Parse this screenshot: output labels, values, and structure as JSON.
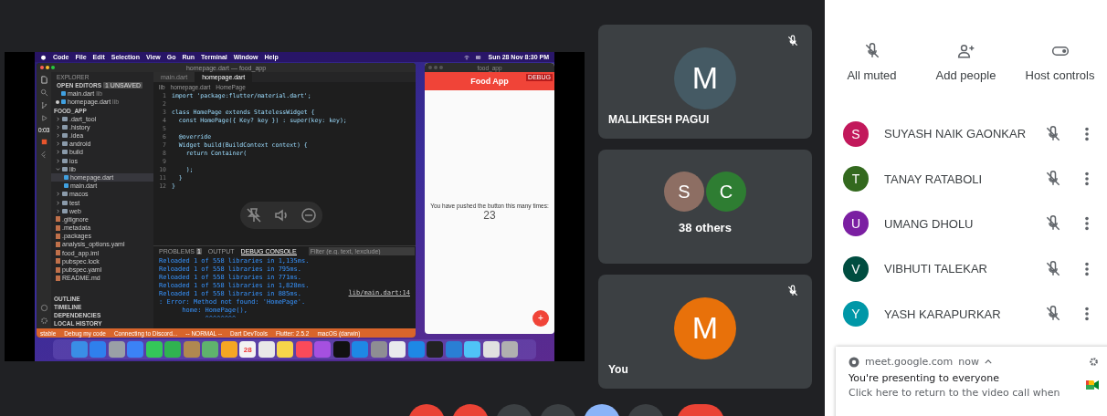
{
  "presentation": {
    "menu_bar": {
      "items": [
        "Code",
        "File",
        "Edit",
        "Selection",
        "View",
        "Go",
        "Run",
        "Terminal",
        "Window",
        "Help"
      ],
      "clock": "Sun 28 Nov 8:30 PM"
    },
    "editor": {
      "title": "homepage.dart — food_app",
      "timer": "0:03",
      "explorer_title": "EXPLORER",
      "open_editors": "OPEN EDITORS",
      "unsaved": "1 UNSAVED",
      "open_files": [
        {
          "name": "main.dart",
          "path": "lib",
          "modified": false
        },
        {
          "name": "homepage.dart",
          "path": "lib",
          "modified": true
        }
      ],
      "project": "FOOD_APP",
      "tree": [
        {
          "name": ".dart_tool",
          "kind": "folder",
          "expanded": false
        },
        {
          "name": ".history",
          "kind": "folder",
          "expanded": false
        },
        {
          "name": ".idea",
          "kind": "folder",
          "expanded": false
        },
        {
          "name": "android",
          "kind": "folder",
          "expanded": false
        },
        {
          "name": "build",
          "kind": "folder",
          "expanded": false
        },
        {
          "name": "ios",
          "kind": "folder",
          "expanded": false
        },
        {
          "name": "lib",
          "kind": "folder",
          "expanded": true,
          "children": [
            {
              "name": "homepage.dart",
              "kind": "file",
              "selected": true
            },
            {
              "name": "main.dart",
              "kind": "file",
              "selected": false
            }
          ]
        },
        {
          "name": "macos",
          "kind": "folder",
          "expanded": false
        },
        {
          "name": "test",
          "kind": "folder",
          "expanded": false
        },
        {
          "name": "web",
          "kind": "folder",
          "expanded": false
        },
        {
          "name": ".gitignore",
          "kind": "file"
        },
        {
          "name": ".metadata",
          "kind": "file"
        },
        {
          "name": ".packages",
          "kind": "file"
        },
        {
          "name": "analysis_options.yaml",
          "kind": "file"
        },
        {
          "name": "food_app.iml",
          "kind": "file"
        },
        {
          "name": "pubspec.lock",
          "kind": "file"
        },
        {
          "name": "pubspec.yaml",
          "kind": "file"
        },
        {
          "name": "README.md",
          "kind": "file"
        }
      ],
      "sections": [
        "OUTLINE",
        "TIMELINE",
        "DEPENDENCIES",
        "LOCAL HISTORY"
      ],
      "tabs": [
        {
          "label": "main.dart",
          "selected": false
        },
        {
          "label": "homepage.dart",
          "selected": true
        }
      ],
      "breadcrumb": [
        "lib",
        "homepage.dart",
        "HomePage"
      ],
      "code": [
        {
          "n": "1",
          "text": "import 'package:flutter/material.dart';"
        },
        {
          "n": "2"
        },
        {
          "n": "3",
          "text": "class HomePage extends StatelessWidget {"
        },
        {
          "n": "4",
          "text": "  const HomePage({ Key? key }) : super(key: key);"
        },
        {
          "n": "5"
        },
        {
          "n": "6",
          "text": "  @override"
        },
        {
          "n": "7",
          "text": "  Widget build(BuildContext context) {"
        },
        {
          "n": "8",
          "text": "    return Container("
        },
        {
          "n": "9"
        },
        {
          "n": "10",
          "text": "    );"
        },
        {
          "n": "11",
          "text": "  }"
        },
        {
          "n": "12",
          "text": "}"
        }
      ],
      "panel_tabs": [
        {
          "label": "PROBLEMS",
          "badge": "1",
          "selected": false
        },
        {
          "label": "OUTPUT",
          "selected": false
        },
        {
          "label": "DEBUG CONSOLE",
          "selected": true
        }
      ],
      "filter_placeholder": "Filter (e.g. text, !exclude)",
      "console": [
        "Reloaded 1 of 558 libraries in 1,135ms.",
        "Reloaded 1 of 558 libraries in 795ms.",
        "Reloaded 1 of 558 libraries in 771ms.",
        "Reloaded 1 of 558 libraries in 1,828ms.",
        "Reloaded 1 of 558 libraries in 885ms.",
        ": Error: Method not found: 'HomePage'.",
        "      home: HomePage(),",
        "            ^^^^^^^^"
      ],
      "console_link": "lib/main.dart:14",
      "status": [
        "stable",
        "Debug my code",
        "Connecting to Discord...",
        "-- NORMAL --",
        "Dart DevTools",
        "Flutter: 2.5.2",
        "macOS (darwin)"
      ]
    },
    "app": {
      "window_title": "food_app",
      "title": "Food App",
      "banner": "DEBUG",
      "message": "You have pushed the button this many times:",
      "counter": "23",
      "fab": "+"
    },
    "dock": [
      {
        "color": "#3a8ee6"
      },
      {
        "color": "#2f80ed"
      },
      {
        "color": "#9aa0a6"
      },
      {
        "color": "#3b82f6"
      },
      {
        "color": "#34c759"
      },
      {
        "color": "#30b350"
      },
      {
        "color": "#b08850"
      },
      {
        "color": "#5fb36d"
      },
      {
        "color": "#f5a623"
      },
      {
        "color": "#f2f2f2",
        "label": "28"
      },
      {
        "color": "#e8e8e8"
      },
      {
        "color": "#f7d54a"
      },
      {
        "color": "#fa4a5a"
      },
      {
        "color": "#a550e0"
      },
      {
        "color": "#111111"
      },
      {
        "color": "#1e88e5"
      },
      {
        "color": "#8e8e93"
      },
      {
        "color": "#e8eaed"
      },
      {
        "color": "#1e88e5"
      },
      {
        "color": "#222222"
      },
      {
        "color": "#2a7fd4"
      },
      {
        "color": "#4fc3f7"
      },
      {
        "color": "#e0e0e0"
      },
      {
        "color": "#b0b0b0"
      }
    ]
  },
  "tiles": [
    {
      "kind": "person",
      "initial": "M",
      "color": "#455a64",
      "name": "MALLIKESH PAGUI",
      "muted": true
    },
    {
      "kind": "group",
      "avatars": [
        {
          "initial": "S",
          "color": "#8d6e63"
        },
        {
          "initial": "C",
          "color": "#2e7d32"
        }
      ],
      "label": "38 others"
    },
    {
      "kind": "person",
      "initial": "M",
      "color": "#e8710a",
      "name": "You",
      "muted": true
    }
  ],
  "people": {
    "actions": [
      {
        "kind": "mute",
        "label": "All muted"
      },
      {
        "kind": "add",
        "label": "Add people"
      },
      {
        "kind": "host",
        "label": "Host controls"
      }
    ],
    "participants": [
      {
        "initial": "S",
        "color": "#c2185b",
        "name": "SUYASH NAIK GAONKAR",
        "muted": true
      },
      {
        "initial": "T",
        "color": "#33691e",
        "name": "TANAY RATABOLI",
        "muted": true
      },
      {
        "initial": "U",
        "color": "#7b1fa2",
        "name": "UMANG DHOLU",
        "muted": true
      },
      {
        "initial": "V",
        "color": "#004d40",
        "name": "VIBHUTI TALEKAR",
        "muted": true
      },
      {
        "initial": "Y",
        "color": "#0097a7",
        "name": "YASH KARAPURKAR",
        "muted": true
      }
    ]
  },
  "notification": {
    "source": "meet.google.com",
    "time": "now",
    "title": "You're presenting to everyone",
    "body": "Click here to return to the video call when"
  },
  "controls": [
    {
      "color": "#ea4335"
    },
    {
      "color": "#ea4335"
    },
    {
      "color": "#3c4043"
    },
    {
      "color": "#3c4043"
    },
    {
      "color": "#8ab4f8"
    },
    {
      "color": "#3c4043"
    },
    {
      "color": "#ea4335",
      "kind": "pill"
    }
  ]
}
